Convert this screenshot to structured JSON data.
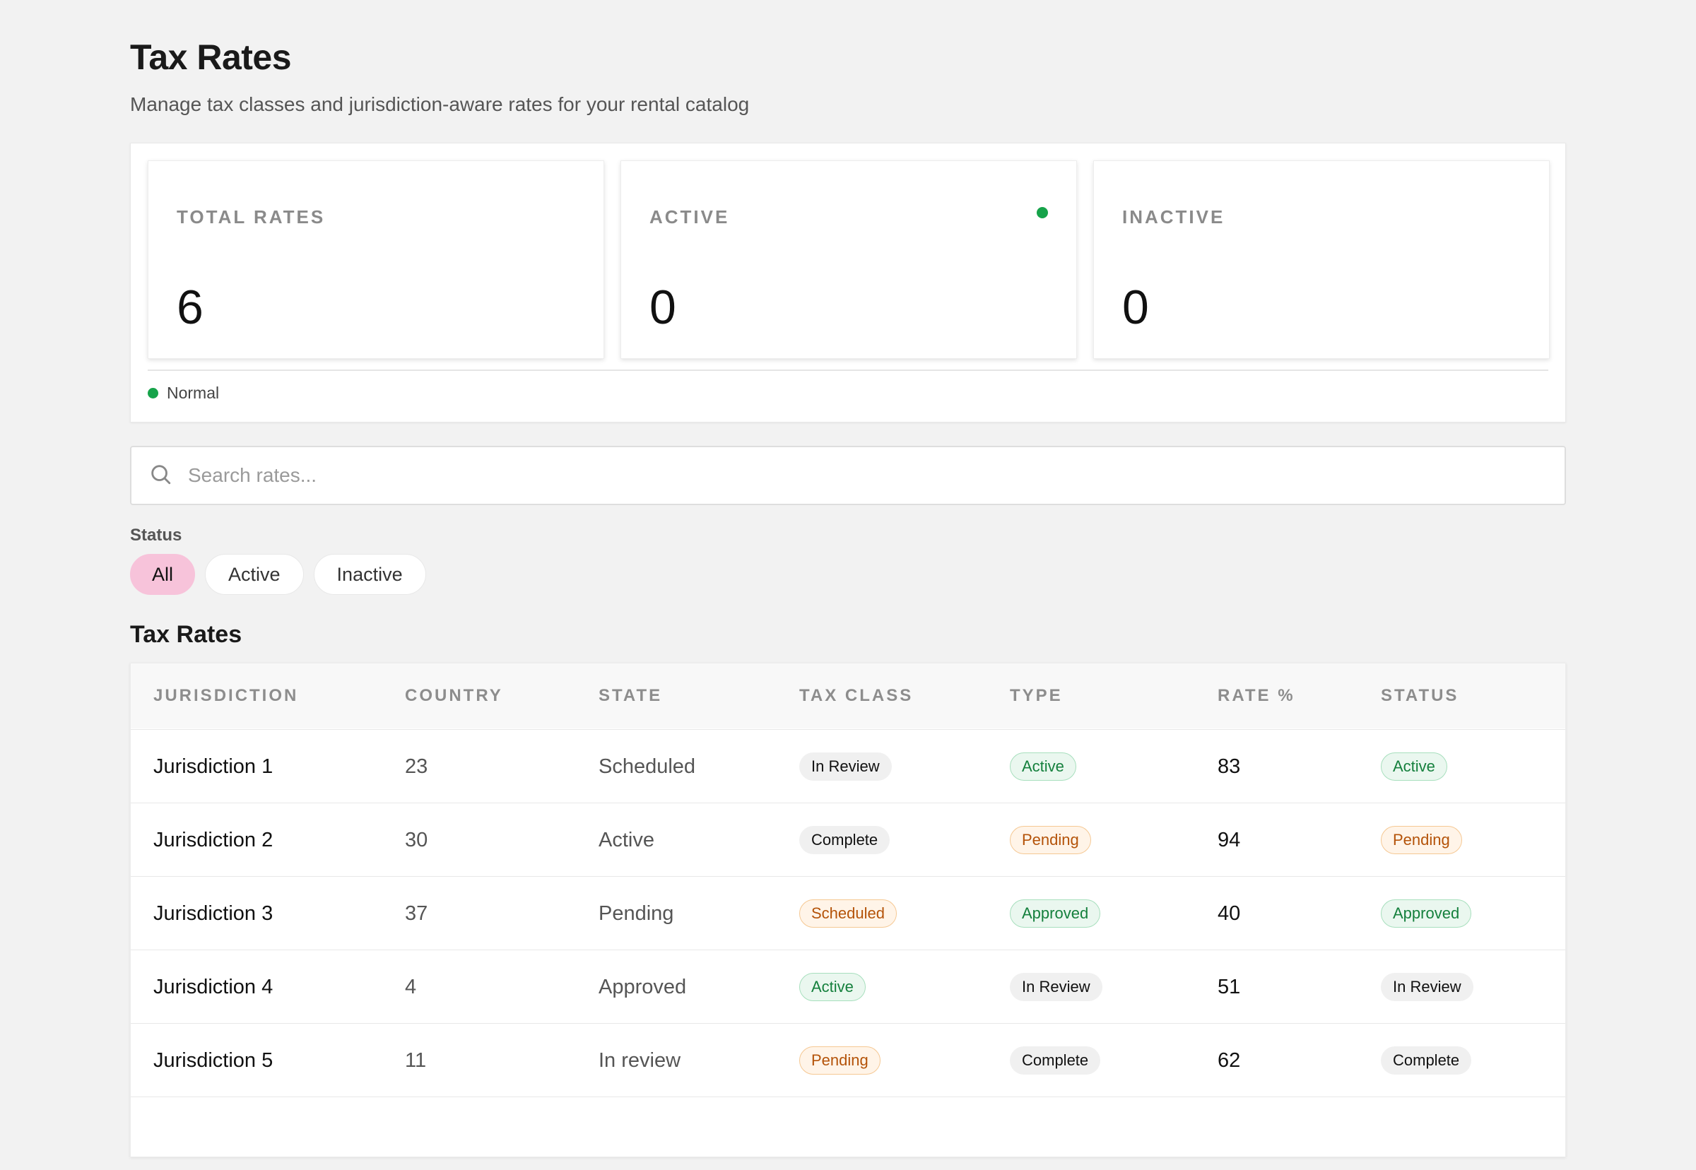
{
  "header": {
    "title": "Tax Rates",
    "subtitle": "Manage tax classes and jurisdiction-aware rates for your rental catalog"
  },
  "stats": [
    {
      "label": "TOTAL RATES",
      "value": "6"
    },
    {
      "label": "ACTIVE",
      "value": "0"
    },
    {
      "label": "INACTIVE",
      "value": "0"
    }
  ],
  "status_indicator": {
    "text": "Normal",
    "color": "#16a34a"
  },
  "search": {
    "placeholder": "Search rates...",
    "value": ""
  },
  "filters": {
    "label": "Status",
    "options": [
      "All",
      "Active",
      "Inactive"
    ],
    "selected": "All"
  },
  "table": {
    "title": "Tax Rates",
    "columns": [
      "JURISDICTION",
      "COUNTRY",
      "STATE",
      "TAX CLASS",
      "TYPE",
      "RATE %",
      "STATUS"
    ],
    "rows": [
      {
        "jurisdiction": "Jurisdiction 1",
        "country": "23",
        "state": "Scheduled",
        "tax_class": "In Review",
        "type": "Active",
        "rate": "83",
        "status": "Active"
      },
      {
        "jurisdiction": "Jurisdiction 2",
        "country": "30",
        "state": "Active",
        "tax_class": "Complete",
        "type": "Pending",
        "rate": "94",
        "status": "Pending"
      },
      {
        "jurisdiction": "Jurisdiction 3",
        "country": "37",
        "state": "Pending",
        "tax_class": "Scheduled",
        "type": "Approved",
        "rate": "40",
        "status": "Approved"
      },
      {
        "jurisdiction": "Jurisdiction 4",
        "country": "4",
        "state": "Approved",
        "tax_class": "Active",
        "type": "In Review",
        "rate": "51",
        "status": "In Review"
      },
      {
        "jurisdiction": "Jurisdiction 5",
        "country": "11",
        "state": "In review",
        "tax_class": "Pending",
        "type": "Complete",
        "rate": "62",
        "status": "Complete"
      }
    ]
  },
  "colors": {
    "accent_chip": "#f7c3da",
    "badge_green": "#15803d",
    "badge_orange": "#b45309"
  },
  "icons": {
    "search": "search-icon"
  }
}
